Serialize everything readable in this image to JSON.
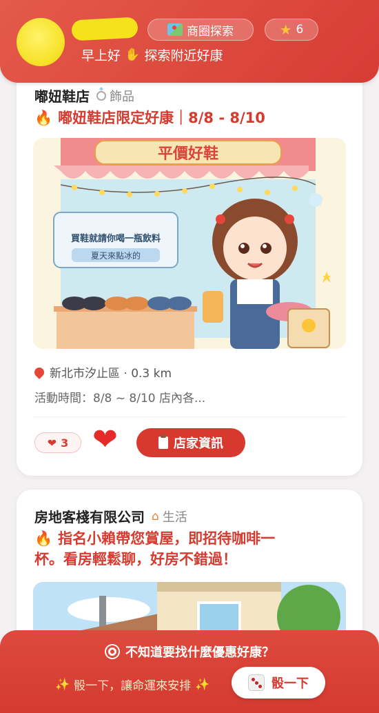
{
  "header": {
    "explore_label": "商圈探索",
    "star_count": "6",
    "greeting": "早上好",
    "greeting_tail": "探索附近好康"
  },
  "cards": [
    {
      "store_name": "嘟妞鞋店",
      "category": "飾品",
      "promo_title": "嘟妞鞋店限定好康｜8/8 - 8/10",
      "banner_sign": "買鞋就請你喝一瓶飲料",
      "banner_sub": "夏天來點冰的",
      "banner_top": "平價好鞋",
      "location": "新北市汐止區 · 0.3 km",
      "time": "活動時間：8/8 ~ 8/10 店內各...",
      "likes": "3",
      "info_button": "店家資訊"
    },
    {
      "store_name": "房地客棧有限公司",
      "category": "生活",
      "promo_title_line1": "指名小賴帶您賞屋，即招待咖啡一",
      "promo_title_line2": "杯。看房輕鬆聊，好房不錯過！"
    }
  ],
  "bottom": {
    "question": "不知道要找什麼優惠好康？",
    "subtitle": "骰一下，讓命運來安排",
    "roll_button": "骰一下"
  },
  "colors": {
    "brand_red": "#d8392f",
    "header_red": "#e35a4a",
    "accent_yellow": "#ffc53a"
  }
}
